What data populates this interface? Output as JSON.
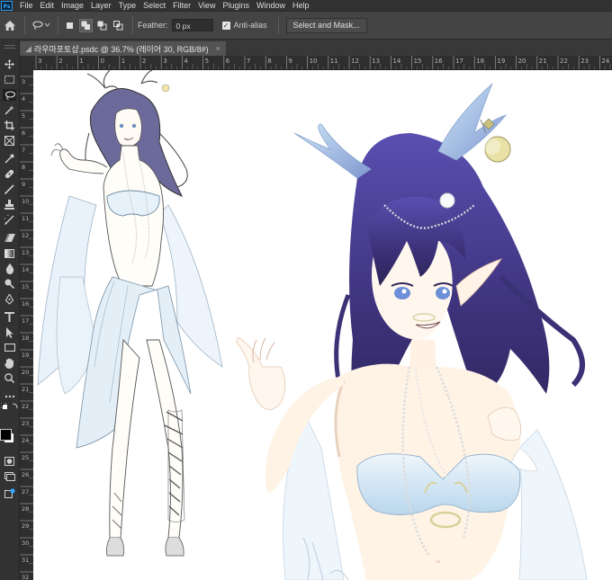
{
  "app": {
    "logo": "Ps"
  },
  "menu": [
    "File",
    "Edit",
    "Image",
    "Layer",
    "Type",
    "Select",
    "Filter",
    "View",
    "Plugins",
    "Window",
    "Help"
  ],
  "options": {
    "home_icon": "home-icon",
    "tool_icon": "lasso-icon",
    "feather_label": "Feather:",
    "feather_value": "0 px",
    "antialias_label": "Anti-alias",
    "antialias_checked": true,
    "select_mask_label": "Select and Mask..."
  },
  "document": {
    "tab_title": "라우마포토샵.psdc @ 36.7% (레이어 30, RGB/8#)",
    "close_glyph": "×"
  },
  "ruler": {
    "top_numbers": [
      "3",
      "2",
      "1",
      "0",
      "1",
      "2",
      "3",
      "4",
      "5",
      "6",
      "7",
      "8",
      "9",
      "10",
      "11",
      "12",
      "13",
      "14",
      "15",
      "16",
      "17",
      "18",
      "19",
      "20",
      "21",
      "22",
      "23",
      "24"
    ],
    "left_numbers": [
      "3",
      "4",
      "5",
      "6",
      "7",
      "8",
      "9",
      "10",
      "11",
      "12",
      "13",
      "14",
      "15",
      "16",
      "17",
      "18",
      "19",
      "20",
      "21",
      "22",
      "23",
      "24",
      "25",
      "26",
      "27",
      "28",
      "29",
      "30",
      "31",
      "32"
    ]
  },
  "tools": [
    "move-tool",
    "marquee-tool",
    "lasso-tool",
    "magic-wand-tool",
    "crop-tool",
    "frame-tool",
    "eyedropper-tool",
    "healing-tool",
    "brush-tool",
    "clone-stamp-tool",
    "history-brush-tool",
    "eraser-tool",
    "gradient-tool",
    "blur-tool",
    "dodge-tool",
    "pen-tool",
    "type-tool",
    "path-selection-tool",
    "rectangle-tool",
    "hand-tool",
    "zoom-tool",
    "more-tools",
    "default-colors",
    "quick-mask",
    "screen-mode",
    "share"
  ],
  "colors": {
    "foreground": "#000000",
    "background": "#ffffff",
    "accent": "#31a8ff"
  },
  "artwork": {
    "description_visible": false,
    "layers": [
      "full-body sketch",
      "upper-body colored illustration"
    ]
  }
}
